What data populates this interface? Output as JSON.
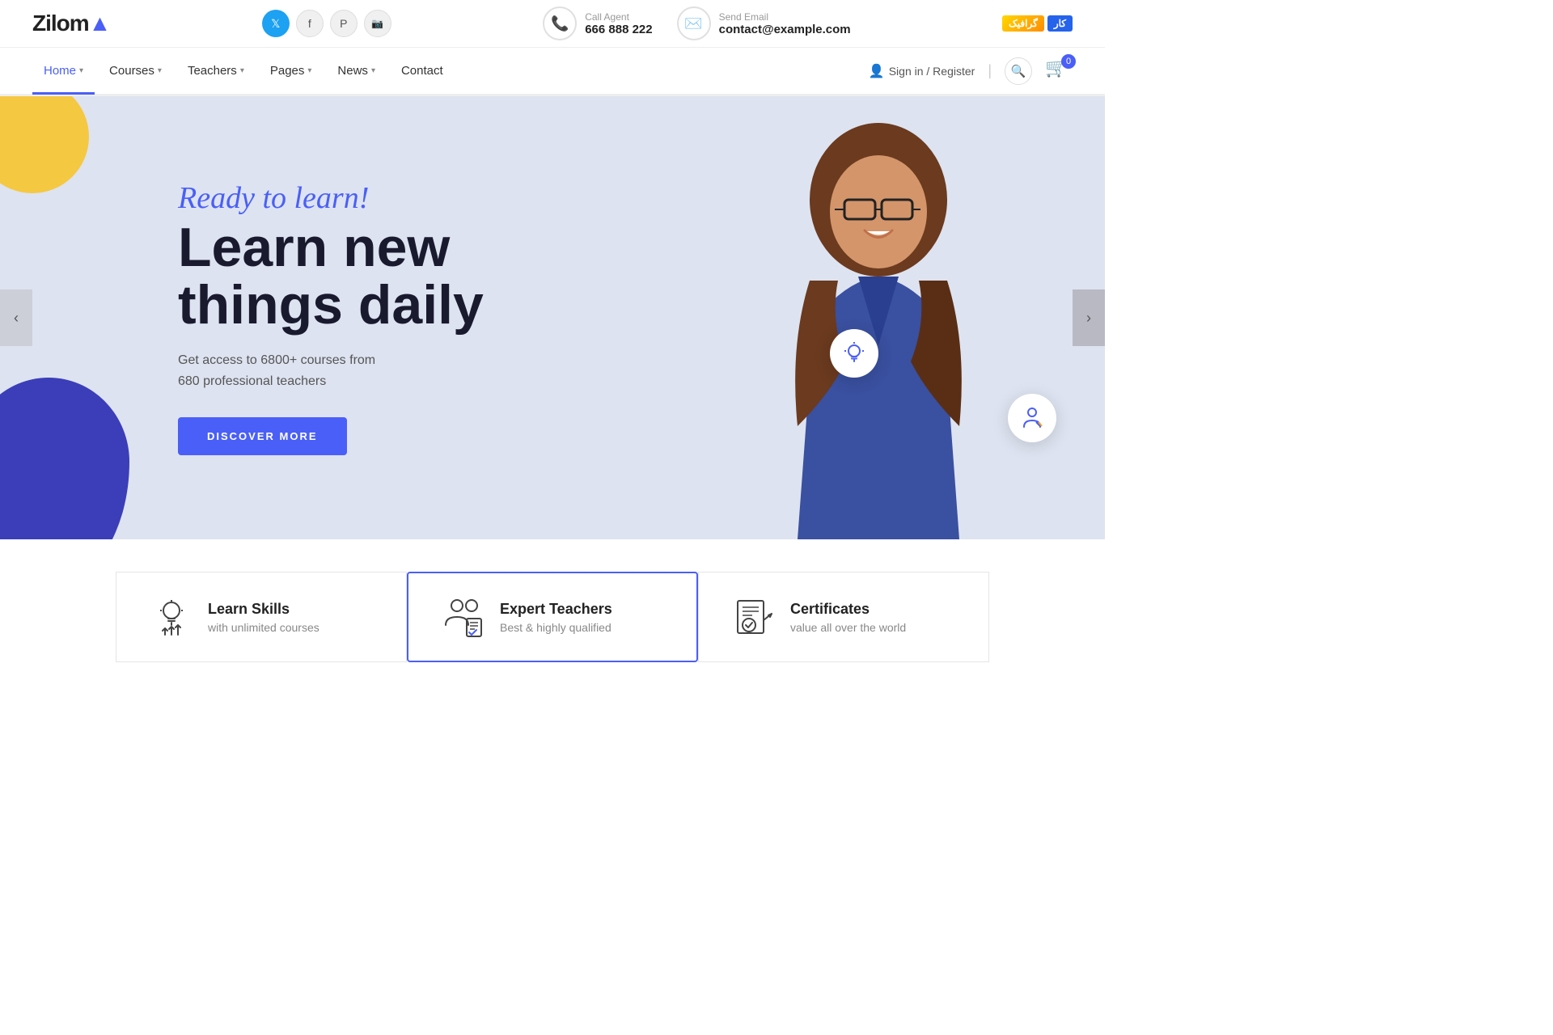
{
  "topbar": {
    "logo_text": "Zilom",
    "social": [
      {
        "name": "twitter",
        "symbol": "𝕏"
      },
      {
        "name": "facebook",
        "symbol": "f"
      },
      {
        "name": "pinterest",
        "symbol": "P"
      },
      {
        "name": "instagram",
        "symbol": "📷"
      }
    ],
    "call_label": "Call Agent",
    "call_number": "666 888 222",
    "email_label": "Send Email",
    "email_value": "contact@example.com"
  },
  "navbar": {
    "items": [
      {
        "label": "Home",
        "has_arrow": true,
        "active": true
      },
      {
        "label": "Courses",
        "has_arrow": true,
        "active": false
      },
      {
        "label": "Teachers",
        "has_arrow": true,
        "active": false
      },
      {
        "label": "Pages",
        "has_arrow": true,
        "active": false
      },
      {
        "label": "News",
        "has_arrow": true,
        "active": false
      },
      {
        "label": "Contact",
        "has_arrow": false,
        "active": false
      }
    ],
    "sign_in_label": "Sign in / Register",
    "cart_count": "0"
  },
  "hero": {
    "subtitle": "Ready to learn!",
    "title_line1": "Learn new",
    "title_line2": "things daily",
    "description": "Get access to 6800+ courses from\n680 professional teachers",
    "cta_button": "DISCOVER MORE",
    "floating_icon_1": "💡",
    "floating_icon_2": "👤"
  },
  "features": [
    {
      "id": "learn-skills",
      "title": "Learn Skills",
      "subtitle": "with unlimited courses",
      "active": false
    },
    {
      "id": "expert-teachers",
      "title": "Expert Teachers",
      "subtitle": "Best & highly qualified",
      "active": true
    },
    {
      "id": "certificates",
      "title": "Certificates",
      "subtitle": "value all over the world",
      "active": false
    }
  ],
  "colors": {
    "primary": "#4a5ff7",
    "dark": "#1a1a2e",
    "hero_bg": "#dde3f0"
  }
}
